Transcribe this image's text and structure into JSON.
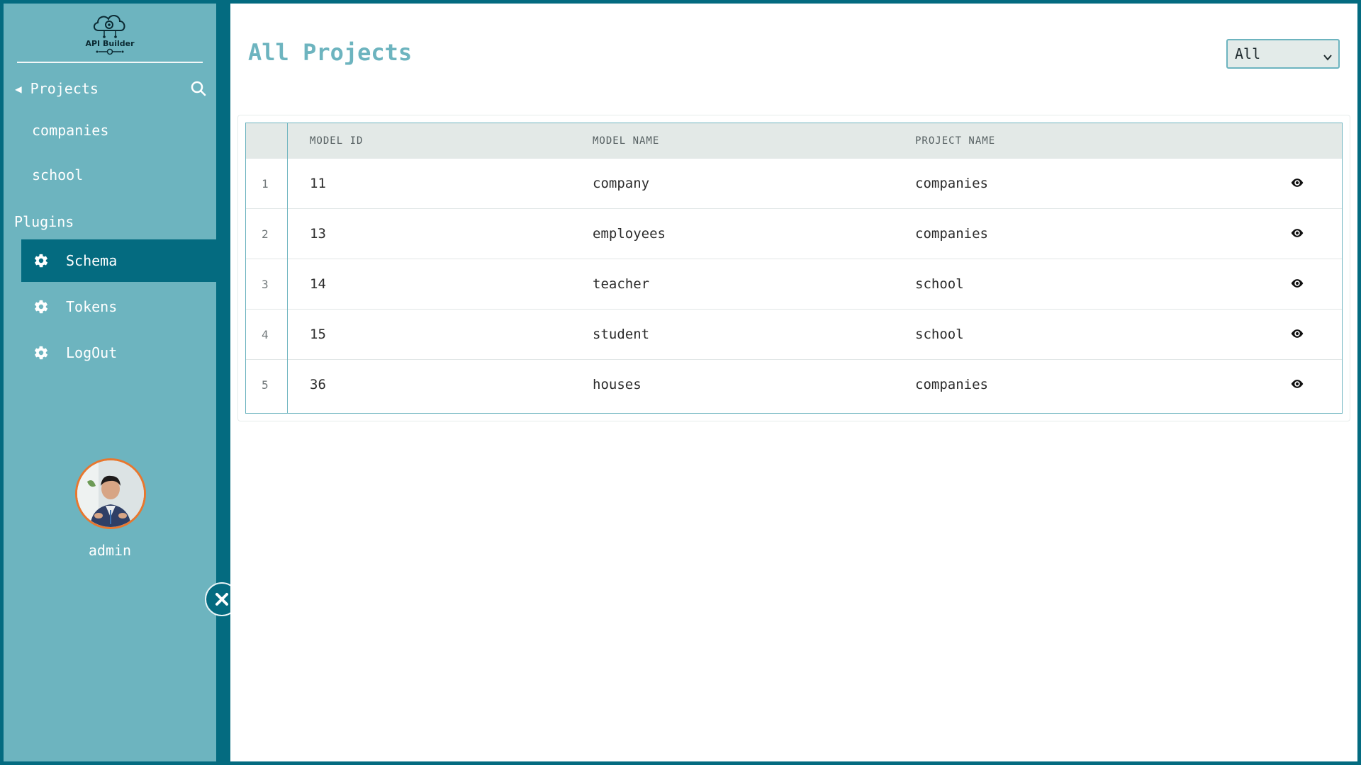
{
  "app": {
    "logo_text": "API Builder"
  },
  "sidebar": {
    "projects_label": "Projects",
    "projects": [
      {
        "label": "companies"
      },
      {
        "label": "school"
      }
    ],
    "plugins_label": "Plugins",
    "plugins": [
      {
        "label": "Schema",
        "active": true,
        "icon": "gear-icon"
      },
      {
        "label": "Tokens",
        "active": false,
        "icon": "gear-icon"
      },
      {
        "label": "LogOut",
        "active": false,
        "icon": "gear-icon"
      }
    ],
    "user": {
      "name": "admin"
    }
  },
  "main": {
    "title": "All Projects",
    "filter": {
      "selected": "All"
    },
    "table": {
      "headers": [
        "MODEL ID",
        "MODEL NAME",
        "PROJECT NAME"
      ],
      "rows": [
        {
          "index": "1",
          "model_id": "11",
          "model_name": "company",
          "project_name": "companies"
        },
        {
          "index": "2",
          "model_id": "13",
          "model_name": "employees",
          "project_name": "companies"
        },
        {
          "index": "3",
          "model_id": "14",
          "model_name": "teacher",
          "project_name": "school"
        },
        {
          "index": "4",
          "model_id": "15",
          "model_name": "student",
          "project_name": "school"
        },
        {
          "index": "5",
          "model_id": "36",
          "model_name": "houses",
          "project_name": "companies"
        }
      ]
    }
  },
  "colors": {
    "accent": "#046b80",
    "sidebar": "#6db4bf",
    "avatar_border": "#e8772e"
  }
}
